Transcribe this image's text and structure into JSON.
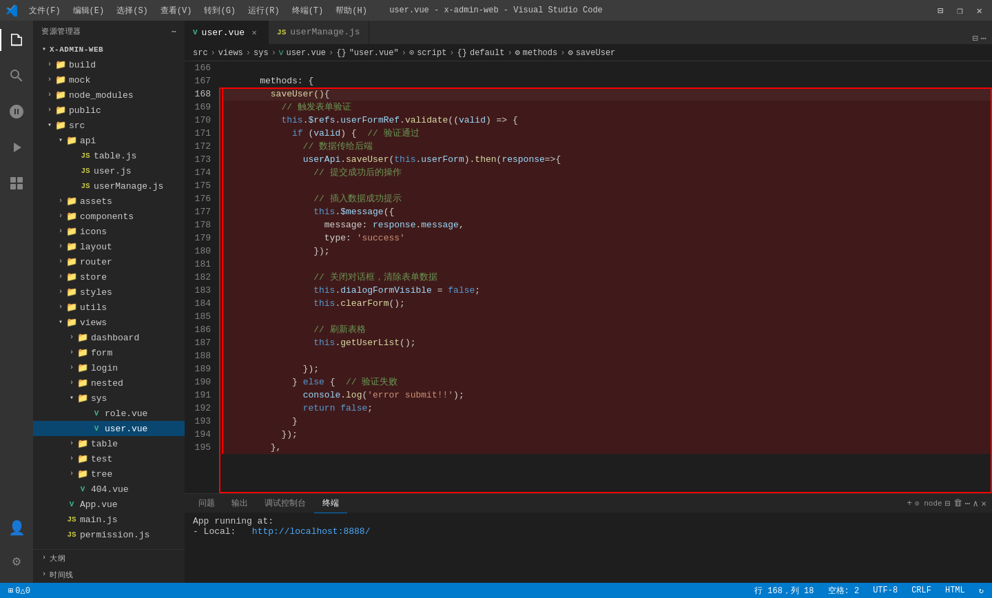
{
  "titleBar": {
    "menus": [
      "文件(F)",
      "编辑(E)",
      "选择(S)",
      "查看(V)",
      "转到(G)",
      "运行(R)",
      "终端(T)",
      "帮助(H)"
    ],
    "title": "user.vue - x-admin-web - Visual Studio Code",
    "windowControls": [
      "⊟",
      "❐",
      "✕"
    ]
  },
  "activityBar": {
    "icons": [
      "explorer",
      "search",
      "source-control",
      "run",
      "extensions",
      "account",
      "settings"
    ]
  },
  "sidebar": {
    "header": "资源管理器",
    "root": "X-ADMIN-WEB",
    "items": [
      {
        "label": "build",
        "indent": 1,
        "type": "folder",
        "expanded": false
      },
      {
        "label": "mock",
        "indent": 1,
        "type": "folder",
        "expanded": false
      },
      {
        "label": "node_modules",
        "indent": 1,
        "type": "folder",
        "expanded": false
      },
      {
        "label": "public",
        "indent": 1,
        "type": "folder",
        "expanded": false
      },
      {
        "label": "src",
        "indent": 1,
        "type": "folder",
        "expanded": true
      },
      {
        "label": "api",
        "indent": 2,
        "type": "folder",
        "expanded": true
      },
      {
        "label": "table.js",
        "indent": 3,
        "type": "js"
      },
      {
        "label": "user.js",
        "indent": 3,
        "type": "js"
      },
      {
        "label": "userManage.js",
        "indent": 3,
        "type": "js"
      },
      {
        "label": "assets",
        "indent": 2,
        "type": "folder",
        "expanded": false
      },
      {
        "label": "components",
        "indent": 2,
        "type": "folder",
        "expanded": false
      },
      {
        "label": "icons",
        "indent": 2,
        "type": "folder",
        "expanded": false
      },
      {
        "label": "layout",
        "indent": 2,
        "type": "folder",
        "expanded": false
      },
      {
        "label": "router",
        "indent": 2,
        "type": "folder",
        "expanded": false
      },
      {
        "label": "store",
        "indent": 2,
        "type": "folder",
        "expanded": false
      },
      {
        "label": "styles",
        "indent": 2,
        "type": "folder",
        "expanded": false
      },
      {
        "label": "utils",
        "indent": 2,
        "type": "folder",
        "expanded": false
      },
      {
        "label": "views",
        "indent": 2,
        "type": "folder",
        "expanded": true
      },
      {
        "label": "dashboard",
        "indent": 3,
        "type": "folder",
        "expanded": false
      },
      {
        "label": "form",
        "indent": 3,
        "type": "folder",
        "expanded": false
      },
      {
        "label": "login",
        "indent": 3,
        "type": "folder",
        "expanded": false
      },
      {
        "label": "nested",
        "indent": 3,
        "type": "folder",
        "expanded": false
      },
      {
        "label": "sys",
        "indent": 3,
        "type": "folder",
        "expanded": true
      },
      {
        "label": "role.vue",
        "indent": 4,
        "type": "vue"
      },
      {
        "label": "user.vue",
        "indent": 4,
        "type": "vue",
        "selected": true
      },
      {
        "label": "table",
        "indent": 3,
        "type": "folder",
        "expanded": false
      },
      {
        "label": "test",
        "indent": 3,
        "type": "folder",
        "expanded": false
      },
      {
        "label": "tree",
        "indent": 3,
        "type": "folder",
        "expanded": false
      },
      {
        "label": "404.vue",
        "indent": 3,
        "type": "vue"
      },
      {
        "label": "App.vue",
        "indent": 2,
        "type": "vue"
      },
      {
        "label": "main.js",
        "indent": 2,
        "type": "js"
      },
      {
        "label": "permission.js",
        "indent": 2,
        "type": "js"
      }
    ],
    "footer": [
      {
        "label": "大纲",
        "indent": 0
      },
      {
        "label": "时间线",
        "indent": 0
      }
    ]
  },
  "tabs": [
    {
      "label": "user.vue",
      "type": "vue",
      "active": true,
      "closable": true
    },
    {
      "label": "userManage.js",
      "type": "js",
      "active": false,
      "closable": false
    }
  ],
  "breadcrumb": [
    "src",
    ">",
    "views",
    ">",
    "sys",
    ">",
    "user.vue",
    ">",
    "{}",
    "\"user.vue\"",
    ">",
    "⚙",
    "script",
    ">",
    "{}",
    "default",
    ">",
    "⚙",
    "methods",
    ">",
    "⚙",
    "saveUser"
  ],
  "codeLines": [
    {
      "num": 166,
      "tokens": []
    },
    {
      "num": 167,
      "tokens": [
        {
          "t": "    methods: {",
          "c": "c-white"
        }
      ]
    },
    {
      "num": 168,
      "tokens": [
        {
          "t": "      saveUser()",
          "c": "c-yellow"
        },
        {
          "t": "{",
          "c": "c-white"
        }
      ],
      "highlighted": true,
      "currentLine": true
    },
    {
      "num": 169,
      "tokens": [
        {
          "t": "        // 触发表单验证",
          "c": "c-green"
        }
      ],
      "highlighted": true
    },
    {
      "num": 170,
      "tokens": [
        {
          "t": "        ",
          "c": ""
        },
        {
          "t": "this",
          "c": "c-blue"
        },
        {
          "t": ".",
          "c": "c-white"
        },
        {
          "t": "$refs",
          "c": "c-cyan"
        },
        {
          "t": ".",
          "c": "c-white"
        },
        {
          "t": "userFormRef",
          "c": "c-cyan"
        },
        {
          "t": ".",
          "c": "c-white"
        },
        {
          "t": "validate",
          "c": "c-yellow"
        },
        {
          "t": "((",
          "c": "c-white"
        },
        {
          "t": "valid",
          "c": "c-param"
        },
        {
          "t": ") => {",
          "c": "c-white"
        }
      ],
      "highlighted": true
    },
    {
      "num": 171,
      "tokens": [
        {
          "t": "          ",
          "c": ""
        },
        {
          "t": "if",
          "c": "c-blue"
        },
        {
          "t": " (",
          "c": "c-white"
        },
        {
          "t": "valid",
          "c": "c-param"
        },
        {
          "t": ") {  // 验证通过",
          "c": "c-green"
        }
      ],
      "highlighted": true
    },
    {
      "num": 172,
      "tokens": [
        {
          "t": "            // 数据传给后端",
          "c": "c-green"
        }
      ],
      "highlighted": true
    },
    {
      "num": 173,
      "tokens": [
        {
          "t": "            ",
          "c": ""
        },
        {
          "t": "userApi",
          "c": "c-cyan"
        },
        {
          "t": ".",
          "c": "c-white"
        },
        {
          "t": "saveUser",
          "c": "c-yellow"
        },
        {
          "t": "(",
          "c": "c-white"
        },
        {
          "t": "this",
          "c": "c-blue"
        },
        {
          "t": ".",
          "c": "c-white"
        },
        {
          "t": "userForm",
          "c": "c-cyan"
        },
        {
          "t": ").",
          "c": "c-white"
        },
        {
          "t": "then",
          "c": "c-yellow"
        },
        {
          "t": "(",
          "c": "c-white"
        },
        {
          "t": "response",
          "c": "c-param"
        },
        {
          "t": "=>{",
          "c": "c-white"
        }
      ],
      "highlighted": true
    },
    {
      "num": 174,
      "tokens": [
        {
          "t": "              // 提交成功后的操作",
          "c": "c-green"
        }
      ],
      "highlighted": true
    },
    {
      "num": 175,
      "tokens": [],
      "highlighted": true
    },
    {
      "num": 176,
      "tokens": [
        {
          "t": "              // 插入数据成功提示",
          "c": "c-green"
        }
      ],
      "highlighted": true
    },
    {
      "num": 177,
      "tokens": [
        {
          "t": "              ",
          "c": ""
        },
        {
          "t": "this",
          "c": "c-blue"
        },
        {
          "t": ".",
          "c": "c-white"
        },
        {
          "t": "$message",
          "c": "c-cyan"
        },
        {
          "t": "({",
          "c": "c-white"
        }
      ],
      "highlighted": true
    },
    {
      "num": 178,
      "tokens": [
        {
          "t": "                message: ",
          "c": "c-white"
        },
        {
          "t": "response",
          "c": "c-cyan"
        },
        {
          "t": ".",
          "c": "c-white"
        },
        {
          "t": "message",
          "c": "c-cyan"
        },
        {
          "t": ",",
          "c": "c-white"
        }
      ],
      "highlighted": true
    },
    {
      "num": 179,
      "tokens": [
        {
          "t": "                type: ",
          "c": "c-white"
        },
        {
          "t": "'success'",
          "c": "c-orange"
        }
      ],
      "highlighted": true
    },
    {
      "num": 180,
      "tokens": [
        {
          "t": "              });",
          "c": "c-white"
        }
      ],
      "highlighted": true
    },
    {
      "num": 181,
      "tokens": [],
      "highlighted": true
    },
    {
      "num": 182,
      "tokens": [
        {
          "t": "              // 关闭对话框，清除表单数据",
          "c": "c-green"
        }
      ],
      "highlighted": true
    },
    {
      "num": 183,
      "tokens": [
        {
          "t": "              ",
          "c": ""
        },
        {
          "t": "this",
          "c": "c-blue"
        },
        {
          "t": ".",
          "c": "c-white"
        },
        {
          "t": "dialogFormVisible",
          "c": "c-cyan"
        },
        {
          "t": " = ",
          "c": "c-white"
        },
        {
          "t": "false",
          "c": "c-blue"
        },
        {
          "t": ";",
          "c": "c-white"
        }
      ],
      "highlighted": true
    },
    {
      "num": 184,
      "tokens": [
        {
          "t": "              ",
          "c": ""
        },
        {
          "t": "this",
          "c": "c-blue"
        },
        {
          "t": ".",
          "c": "c-white"
        },
        {
          "t": "clearForm",
          "c": "c-yellow"
        },
        {
          "t": "();",
          "c": "c-white"
        }
      ],
      "highlighted": true
    },
    {
      "num": 185,
      "tokens": [],
      "highlighted": true
    },
    {
      "num": 186,
      "tokens": [
        {
          "t": "              // 刷新表格",
          "c": "c-green"
        }
      ],
      "highlighted": true
    },
    {
      "num": 187,
      "tokens": [
        {
          "t": "              ",
          "c": ""
        },
        {
          "t": "this",
          "c": "c-blue"
        },
        {
          "t": ".",
          "c": "c-white"
        },
        {
          "t": "getUserList",
          "c": "c-yellow"
        },
        {
          "t": "();",
          "c": "c-white"
        }
      ],
      "highlighted": true
    },
    {
      "num": 188,
      "tokens": [],
      "highlighted": true
    },
    {
      "num": 189,
      "tokens": [
        {
          "t": "            });",
          "c": "c-white"
        }
      ],
      "highlighted": true
    },
    {
      "num": 190,
      "tokens": [
        {
          "t": "          } ",
          "c": "c-white"
        },
        {
          "t": "else",
          "c": "c-blue"
        },
        {
          "t": " {  // 验证失败",
          "c": "c-green"
        }
      ],
      "highlighted": true
    },
    {
      "num": 191,
      "tokens": [
        {
          "t": "            ",
          "c": ""
        },
        {
          "t": "console",
          "c": "c-cyan"
        },
        {
          "t": ".",
          "c": "c-white"
        },
        {
          "t": "log",
          "c": "c-yellow"
        },
        {
          "t": "(",
          "c": "c-white"
        },
        {
          "t": "'error submit!!'",
          "c": "c-orange"
        },
        {
          "t": ");",
          "c": "c-white"
        }
      ],
      "highlighted": true
    },
    {
      "num": 192,
      "tokens": [
        {
          "t": "            ",
          "c": ""
        },
        {
          "t": "return",
          "c": "c-blue"
        },
        {
          "t": " ",
          "c": ""
        },
        {
          "t": "false",
          "c": "c-blue"
        },
        {
          "t": ";",
          "c": "c-white"
        }
      ],
      "highlighted": true
    },
    {
      "num": 193,
      "tokens": [
        {
          "t": "          }",
          "c": "c-white"
        }
      ],
      "highlighted": true
    },
    {
      "num": 194,
      "tokens": [
        {
          "t": "        });",
          "c": "c-white"
        }
      ],
      "highlighted": true
    },
    {
      "num": 195,
      "tokens": [
        {
          "t": "      },",
          "c": "c-white"
        }
      ],
      "highlighted": true
    }
  ],
  "panel": {
    "tabs": [
      "问题",
      "输出",
      "调试控制台",
      "终端"
    ],
    "activeTab": "终端",
    "content": [
      "App running at:",
      "  - Local:   http://localhost:8888/"
    ]
  },
  "statusBar": {
    "left": [
      "⊞ 0△0"
    ],
    "right": [
      "行 168，列 18",
      "空格: 2",
      "UTF-8",
      "CRLF",
      "HTML",
      "↻"
    ]
  }
}
